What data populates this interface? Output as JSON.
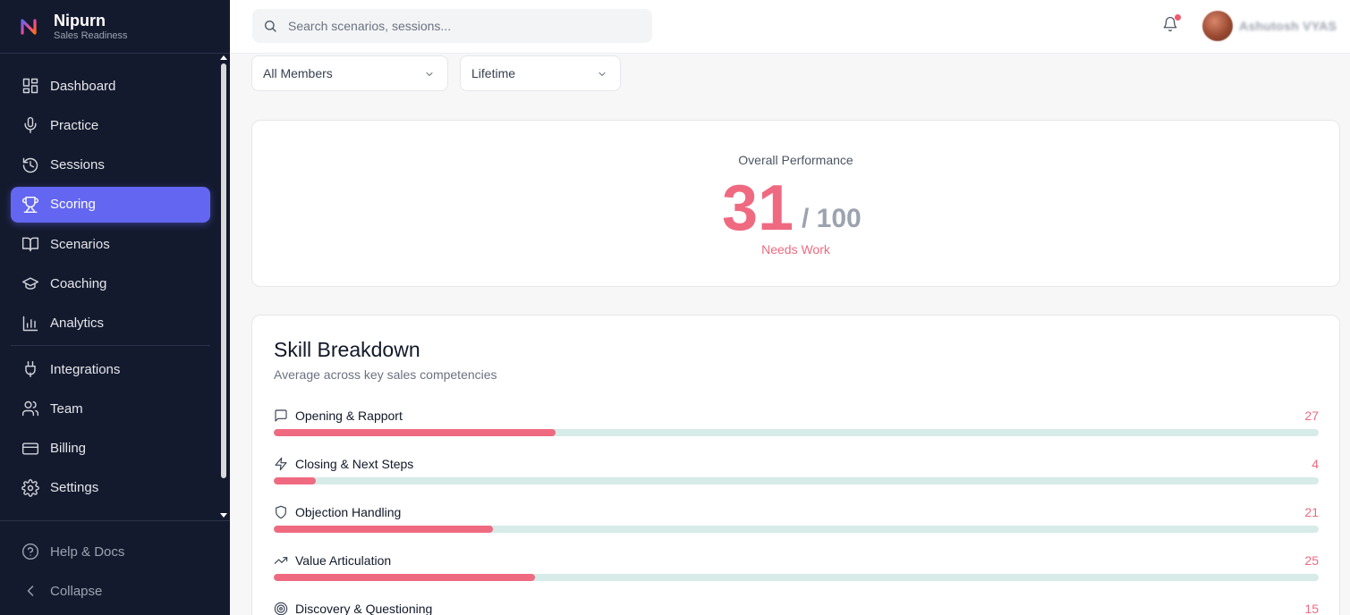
{
  "brand": {
    "name": "Nipurn",
    "subtitle": "Sales Readiness"
  },
  "sidebar": {
    "items": [
      {
        "label": "Dashboard",
        "icon": "dashboard-icon"
      },
      {
        "label": "Practice",
        "icon": "microphone-icon"
      },
      {
        "label": "Sessions",
        "icon": "history-icon"
      },
      {
        "label": "Scoring",
        "icon": "trophy-icon",
        "active": true
      },
      {
        "label": "Scenarios",
        "icon": "book-icon"
      },
      {
        "label": "Coaching",
        "icon": "graduation-cap-icon"
      },
      {
        "label": "Analytics",
        "icon": "bar-chart-icon"
      },
      {
        "label": "Integrations",
        "icon": "plug-icon"
      },
      {
        "label": "Team",
        "icon": "users-icon"
      },
      {
        "label": "Billing",
        "icon": "credit-card-icon"
      },
      {
        "label": "Settings",
        "icon": "gear-icon"
      }
    ],
    "bottom": [
      {
        "label": "Help & Docs",
        "icon": "help-icon"
      },
      {
        "label": "Collapse",
        "icon": "chevron-left-icon"
      }
    ]
  },
  "header": {
    "search_placeholder": "Search scenarios, sessions...",
    "notification_badge": true,
    "user_name": "Ashutosh VYAS"
  },
  "filters": {
    "members": "All Members",
    "period": "Lifetime"
  },
  "performance": {
    "label": "Overall Performance",
    "score": "31",
    "total": "/ 100",
    "status": "Needs Work",
    "accent_color": "#ef6a80"
  },
  "skills": {
    "title": "Skill Breakdown",
    "subtitle": "Average across key sales competencies",
    "items": [
      {
        "name": "Opening & Rapport",
        "value": 27,
        "icon": "message-square-icon"
      },
      {
        "name": "Closing & Next Steps",
        "value": 4,
        "icon": "lightning-icon"
      },
      {
        "name": "Objection Handling",
        "value": 21,
        "icon": "shield-icon"
      },
      {
        "name": "Value Articulation",
        "value": 25,
        "icon": "trending-up-icon"
      },
      {
        "name": "Discovery & Questioning",
        "value": 15,
        "icon": "target-icon"
      }
    ],
    "track_color": "#d7ebe8",
    "fill_color": "#ef6a80"
  }
}
